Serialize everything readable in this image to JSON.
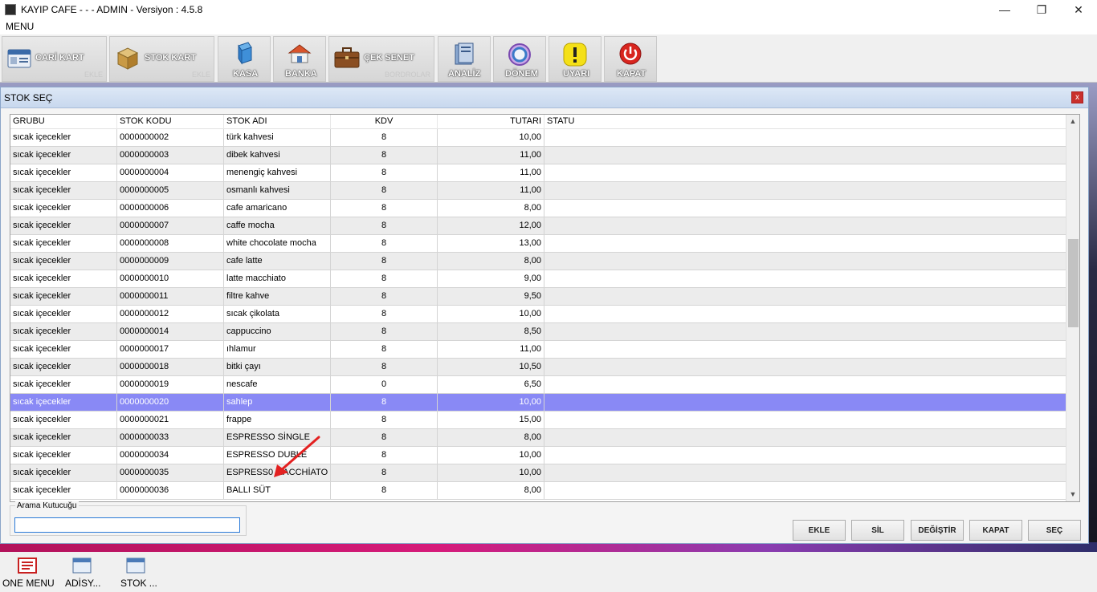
{
  "window": {
    "title": "KAYIP CAFE -  -  - ADMIN -  Versiyon : 4.5.8",
    "minimize": "—",
    "maximize": "❐",
    "close": "✕"
  },
  "menubar": {
    "label": "MENU"
  },
  "toolbar": {
    "items": [
      {
        "label": "CARİ KART",
        "sub": "EKLE"
      },
      {
        "label": "STOK KART",
        "sub": "EKLE"
      },
      {
        "label": "KASA",
        "sub": ""
      },
      {
        "label": "BANKA",
        "sub": ""
      },
      {
        "label": "ÇEK SENET",
        "sub": "BORDROLAR"
      },
      {
        "label": "ANALİZ",
        "sub": ""
      },
      {
        "label": "DÖNEM",
        "sub": ""
      },
      {
        "label": "UYARI",
        "sub": ""
      },
      {
        "label": "KAPAT",
        "sub": ""
      }
    ]
  },
  "dialog": {
    "title": "STOK SEÇ",
    "close": "x",
    "columns": [
      "GRUBU",
      "STOK KODU",
      "STOK ADI",
      "KDV",
      "TUTARI",
      "STATU"
    ],
    "rows": [
      [
        "sıcak içecekler",
        "0000000002",
        "türk kahvesi",
        "8",
        "10,00",
        ""
      ],
      [
        "sıcak içecekler",
        "0000000003",
        "dibek kahvesi",
        "8",
        "11,00",
        ""
      ],
      [
        "sıcak içecekler",
        "0000000004",
        "menengiç kahvesi",
        "8",
        "11,00",
        ""
      ],
      [
        "sıcak içecekler",
        "0000000005",
        "osmanlı kahvesi",
        "8",
        "11,00",
        ""
      ],
      [
        "sıcak içecekler",
        "0000000006",
        "cafe amaricano",
        "8",
        "8,00",
        ""
      ],
      [
        "sıcak içecekler",
        "0000000007",
        "caffe mocha",
        "8",
        "12,00",
        ""
      ],
      [
        "sıcak içecekler",
        "0000000008",
        "white chocolate mocha",
        "8",
        "13,00",
        ""
      ],
      [
        "sıcak içecekler",
        "0000000009",
        "cafe latte",
        "8",
        "8,00",
        ""
      ],
      [
        "sıcak içecekler",
        "0000000010",
        "latte macchiato",
        "8",
        "9,00",
        ""
      ],
      [
        "sıcak içecekler",
        "0000000011",
        "filtre kahve",
        "8",
        "9,50",
        ""
      ],
      [
        "sıcak içecekler",
        "0000000012",
        "sıcak çikolata",
        "8",
        "10,00",
        ""
      ],
      [
        "sıcak içecekler",
        "0000000014",
        "cappuccino",
        "8",
        "8,50",
        ""
      ],
      [
        "sıcak içecekler",
        "0000000017",
        "ıhlamur",
        "8",
        "11,00",
        ""
      ],
      [
        "sıcak içecekler",
        "0000000018",
        "bitki çayı",
        "8",
        "10,50",
        ""
      ],
      [
        "sıcak içecekler",
        "0000000019",
        "nescafe",
        "0",
        "6,50",
        ""
      ],
      [
        "sıcak içecekler",
        "0000000020",
        "sahlep",
        "8",
        "10,00",
        ""
      ],
      [
        "sıcak içecekler",
        "0000000021",
        "frappe",
        "8",
        "15,00",
        ""
      ],
      [
        "sıcak içecekler",
        "0000000033",
        "ESPRESSO SİNGLE",
        "8",
        "8,00",
        ""
      ],
      [
        "sıcak içecekler",
        "0000000034",
        "ESPRESSO DUBLE",
        "8",
        "10,00",
        ""
      ],
      [
        "sıcak içecekler",
        "0000000035",
        "ESPRESS0 MACCHİATO",
        "8",
        "10,00",
        ""
      ],
      [
        "sıcak içecekler",
        "0000000036",
        "BALLI SÜT",
        "8",
        "8,00",
        ""
      ]
    ],
    "selected_row_index": 15,
    "search": {
      "legend": "Arama Kutucuğu",
      "value": ""
    },
    "buttons": {
      "add": "EKLE",
      "delete": "SİL",
      "change": "DEĞİŞTİR",
      "close": "KAPAT",
      "select": "SEÇ"
    }
  },
  "taskbar": {
    "items": [
      {
        "label": "ONE MENU"
      },
      {
        "label": "ADİSY..."
      },
      {
        "label": "STOK ..."
      }
    ]
  },
  "colors": {
    "selected_row": "#8989f5",
    "annotation_arrow": "#e32020",
    "close_button": "#c9302c"
  }
}
